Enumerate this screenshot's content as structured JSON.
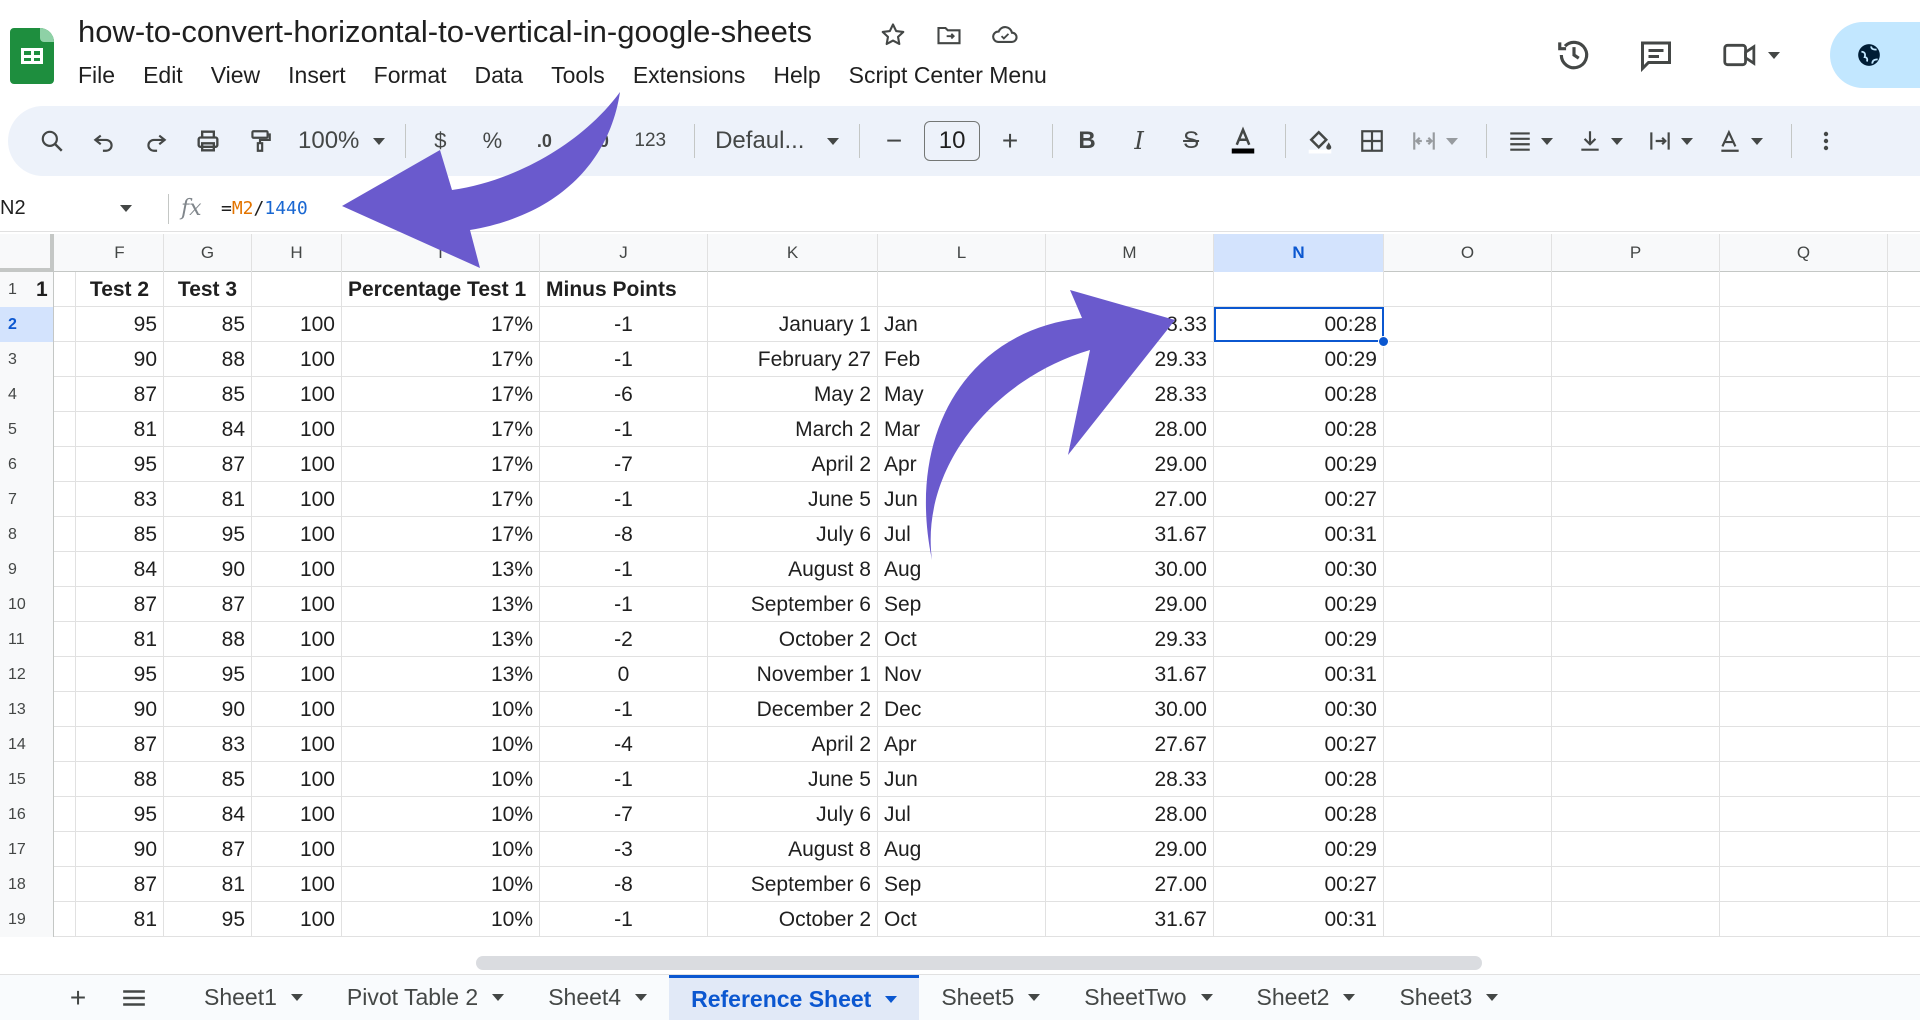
{
  "doc": {
    "title": "how-to-convert-horizontal-to-vertical-in-google-sheets"
  },
  "menu": [
    "File",
    "Edit",
    "View",
    "Insert",
    "Format",
    "Data",
    "Tools",
    "Extensions",
    "Help",
    "Script Center Menu"
  ],
  "toolbar": {
    "zoom": "100%",
    "currency": "$",
    "percent": "%",
    "decimal_less": ".0",
    "decimal_more": ".00",
    "number_format": "123",
    "font": "Defaul...",
    "font_size": "10",
    "minus": "−",
    "plus": "+"
  },
  "formula_bar": {
    "name_box": "N2",
    "fx": "fx",
    "eq": "=",
    "ref": "M2",
    "op": "/",
    "num": "1440"
  },
  "columns": [
    "F",
    "G",
    "H",
    "I",
    "J",
    "K",
    "L",
    "M",
    "N",
    "O",
    "P",
    "Q"
  ],
  "selected_column": "N",
  "header_row": {
    "e": "1",
    "f": "Test 2",
    "g": "Test 3",
    "h": "",
    "i": "Percentage Test 1",
    "j": "Minus Points"
  },
  "rows": [
    {
      "n": "2",
      "f": "95",
      "g": "85",
      "h": "100",
      "i": "17%",
      "j": "-1",
      "k": "January 1",
      "l": "Jan",
      "m": "28.33",
      "nn": "00:28"
    },
    {
      "n": "3",
      "f": "90",
      "g": "88",
      "h": "100",
      "i": "17%",
      "j": "-1",
      "k": "February 27",
      "l": "Feb",
      "m": "29.33",
      "nn": "00:29"
    },
    {
      "n": "4",
      "f": "87",
      "g": "85",
      "h": "100",
      "i": "17%",
      "j": "-6",
      "k": "May 2",
      "l": "May",
      "m": "28.33",
      "nn": "00:28"
    },
    {
      "n": "5",
      "f": "81",
      "g": "84",
      "h": "100",
      "i": "17%",
      "j": "-1",
      "k": "March 2",
      "l": "Mar",
      "m": "28.00",
      "nn": "00:28"
    },
    {
      "n": "6",
      "f": "95",
      "g": "87",
      "h": "100",
      "i": "17%",
      "j": "-7",
      "k": "April 2",
      "l": "Apr",
      "m": "29.00",
      "nn": "00:29"
    },
    {
      "n": "7",
      "f": "83",
      "g": "81",
      "h": "100",
      "i": "17%",
      "j": "-1",
      "k": "June 5",
      "l": "Jun",
      "m": "27.00",
      "nn": "00:27"
    },
    {
      "n": "8",
      "f": "85",
      "g": "95",
      "h": "100",
      "i": "17%",
      "j": "-8",
      "k": "July 6",
      "l": "Jul",
      "m": "31.67",
      "nn": "00:31"
    },
    {
      "n": "9",
      "f": "84",
      "g": "90",
      "h": "100",
      "i": "13%",
      "j": "-1",
      "k": "August 8",
      "l": "Aug",
      "m": "30.00",
      "nn": "00:30"
    },
    {
      "n": "10",
      "f": "87",
      "g": "87",
      "h": "100",
      "i": "13%",
      "j": "-1",
      "k": "September 6",
      "l": "Sep",
      "m": "29.00",
      "nn": "00:29"
    },
    {
      "n": "11",
      "f": "81",
      "g": "88",
      "h": "100",
      "i": "13%",
      "j": "-2",
      "k": "October 2",
      "l": "Oct",
      "m": "29.33",
      "nn": "00:29"
    },
    {
      "n": "12",
      "f": "95",
      "g": "95",
      "h": "100",
      "i": "13%",
      "j": "0",
      "k": "November 1",
      "l": "Nov",
      "m": "31.67",
      "nn": "00:31"
    },
    {
      "n": "13",
      "f": "90",
      "g": "90",
      "h": "100",
      "i": "10%",
      "j": "-1",
      "k": "December 2",
      "l": "Dec",
      "m": "30.00",
      "nn": "00:30"
    },
    {
      "n": "14",
      "f": "87",
      "g": "83",
      "h": "100",
      "i": "10%",
      "j": "-4",
      "k": "April 2",
      "l": "Apr",
      "m": "27.67",
      "nn": "00:27"
    },
    {
      "n": "15",
      "f": "88",
      "g": "85",
      "h": "100",
      "i": "10%",
      "j": "-1",
      "k": "June 5",
      "l": "Jun",
      "m": "28.33",
      "nn": "00:28"
    },
    {
      "n": "16",
      "f": "95",
      "g": "84",
      "h": "100",
      "i": "10%",
      "j": "-7",
      "k": "July 6",
      "l": "Jul",
      "m": "28.00",
      "nn": "00:28"
    },
    {
      "n": "17",
      "f": "90",
      "g": "87",
      "h": "100",
      "i": "10%",
      "j": "-3",
      "k": "August 8",
      "l": "Aug",
      "m": "29.00",
      "nn": "00:29"
    },
    {
      "n": "18",
      "f": "87",
      "g": "81",
      "h": "100",
      "i": "10%",
      "j": "-8",
      "k": "September 6",
      "l": "Sep",
      "m": "27.00",
      "nn": "00:27"
    },
    {
      "n": "19",
      "f": "81",
      "g": "95",
      "h": "100",
      "i": "10%",
      "j": "-1",
      "k": "October 2",
      "l": "Oct",
      "m": "31.67",
      "nn": "00:31"
    }
  ],
  "first_row_number": "1",
  "sheet_tabs": [
    "Sheet1",
    "Pivot Table 2",
    "Sheet4",
    "Reference Sheet",
    "Sheet5",
    "SheetTwo",
    "Sheet2",
    "Sheet3"
  ],
  "active_tab": "Reference Sheet",
  "colors": {
    "accent": "#0b57d0",
    "arrow": "#6a5acd",
    "sheets_green": "#1e8e3e"
  }
}
